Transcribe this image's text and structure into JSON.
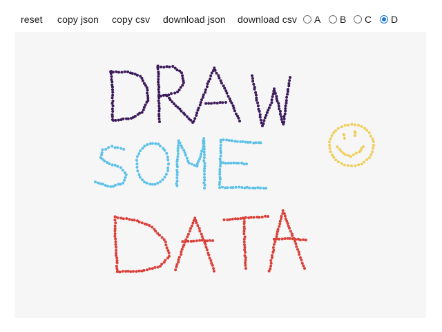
{
  "toolbar": {
    "reset_label": "reset",
    "copy_json_label": "copy json",
    "copy_csv_label": "copy csv",
    "download_json_label": "download json",
    "download_csv_label": "download csv"
  },
  "classes": {
    "options": [
      "A",
      "B",
      "C",
      "D"
    ],
    "selected": "D"
  },
  "colors": {
    "canvas_bg": "#f6f6f6",
    "A": "#3c1a5b",
    "B": "#5ec1e8",
    "C": "#f0cf5e",
    "D": "#d9413a",
    "radio_accent": "#1a73e8"
  },
  "drawing": {
    "words": [
      {
        "text": "DRAW",
        "class": "A"
      },
      {
        "text": "SOME",
        "class": "B"
      },
      {
        "text": "DATA",
        "class": "D"
      }
    ],
    "extra": {
      "shape": "smiley-face",
      "class": "C"
    }
  }
}
